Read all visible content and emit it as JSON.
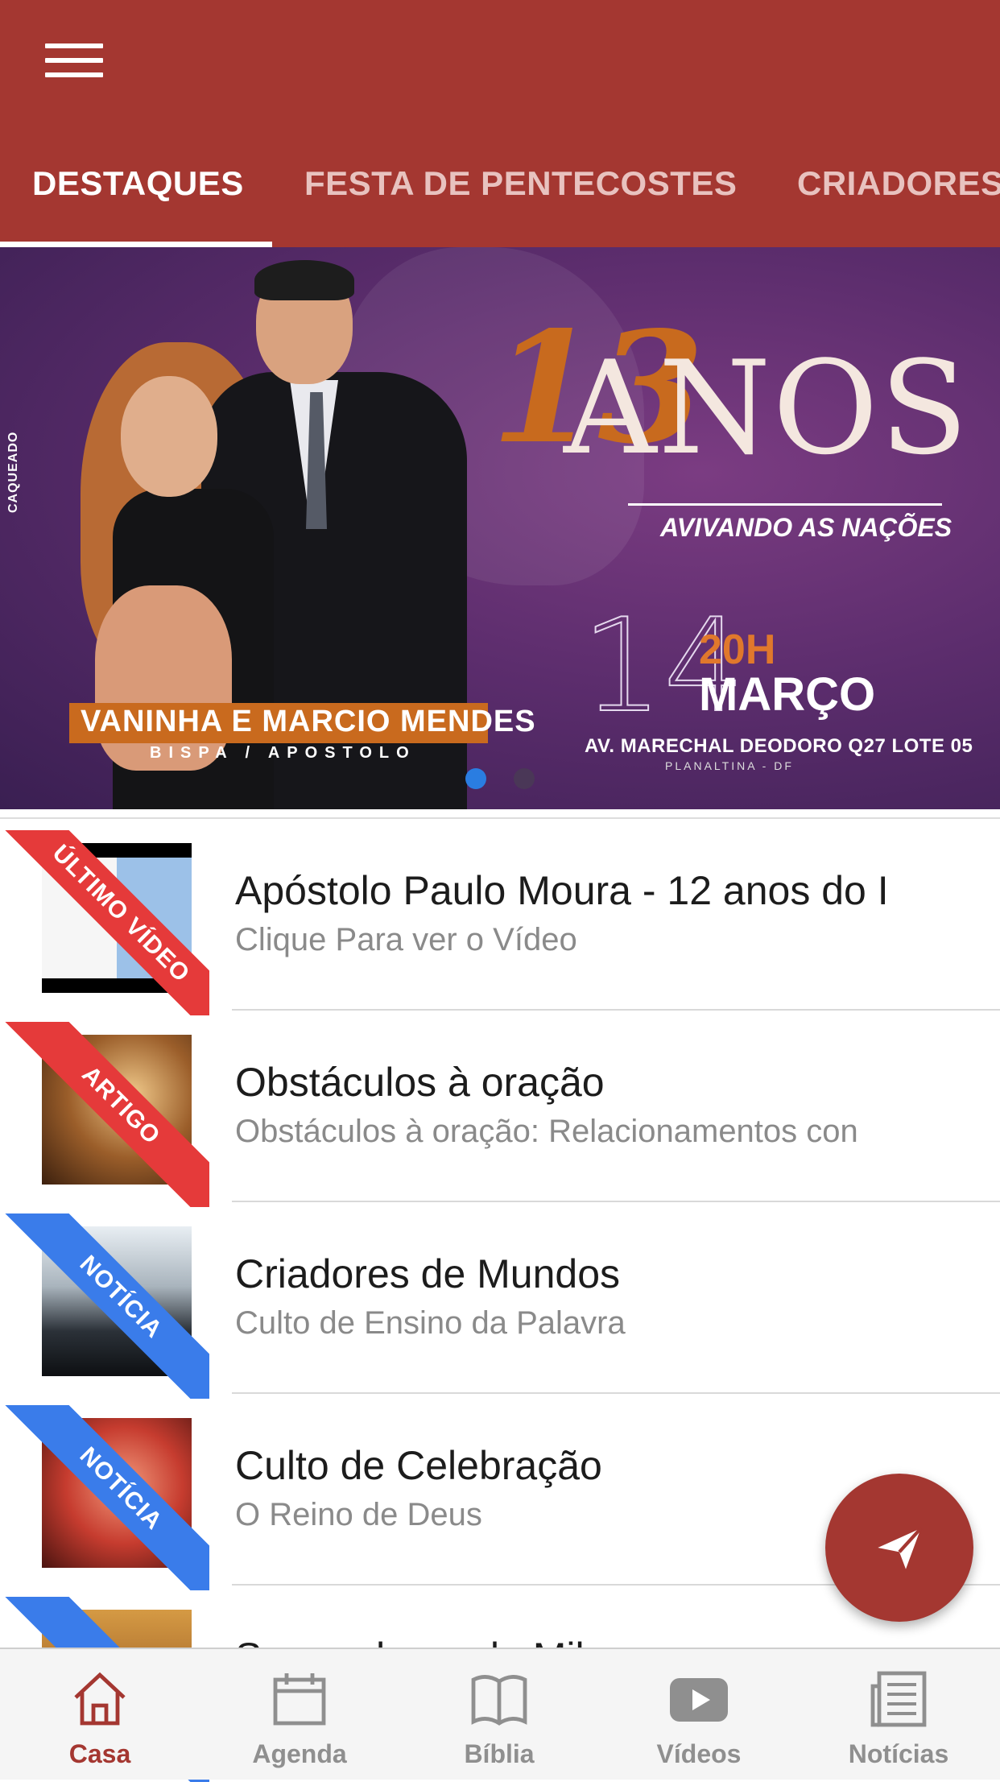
{
  "colors": {
    "primary": "#a43731",
    "tab_inactive": "#e8c2bf",
    "ribbon_red": "#e53a3a",
    "ribbon_blue": "#3a7cea",
    "dot_active": "#2a7de1"
  },
  "tabs": [
    {
      "label": "DESTAQUES",
      "active": true
    },
    {
      "label": "FESTA DE PENTECOSTES",
      "active": false
    },
    {
      "label": "CRIADORES",
      "active": false
    }
  ],
  "banner": {
    "brand": "CAQUEADO",
    "number": "13",
    "title": "ANOS",
    "tagline": "AVIVANDO AS NAÇÕES",
    "day": "14",
    "time": "20H",
    "month": "MARÇO",
    "address": "AV. MARECHAL DEODORO Q27 LOTE 05",
    "city": "PLANALTINA - DF",
    "names": "VANINHA E MARCIO MENDES",
    "roles": "BISPA / APOSTOLO",
    "active_slide": 1,
    "slides": 2
  },
  "items": [
    {
      "badge": "ÚLTIMO VÍDEO",
      "badge_color": "red",
      "title": "Apóstolo Paulo Moura - 12 anos do I",
      "subtitle": "Clique Para ver o Vídeo"
    },
    {
      "badge": "ARTIGO",
      "badge_color": "red",
      "title": "Obstáculos à oração",
      "subtitle": "Obstáculos à oração:  Relacionamentos con"
    },
    {
      "badge": "NOTÍCIA",
      "badge_color": "blue",
      "title": "Criadores de Mundos",
      "subtitle": "Culto de Ensino da Palavra"
    },
    {
      "badge": "NOTÍCIA",
      "badge_color": "blue",
      "title": "Culto de Celebração",
      "subtitle": "O Reino de Deus"
    },
    {
      "badge": "N",
      "badge_color": "blue",
      "title": "Semeadouro de Mil",
      "subtitle": ""
    }
  ],
  "fab": {
    "icon": "send-icon"
  },
  "bottom_nav": [
    {
      "label": "Casa",
      "icon": "home-icon",
      "active": true
    },
    {
      "label": "Agenda",
      "icon": "calendar-icon",
      "active": false
    },
    {
      "label": "Bíblia",
      "icon": "book-icon",
      "active": false
    },
    {
      "label": "Vídeos",
      "icon": "play-icon",
      "active": false
    },
    {
      "label": "Notícias",
      "icon": "news-icon",
      "active": false
    }
  ]
}
